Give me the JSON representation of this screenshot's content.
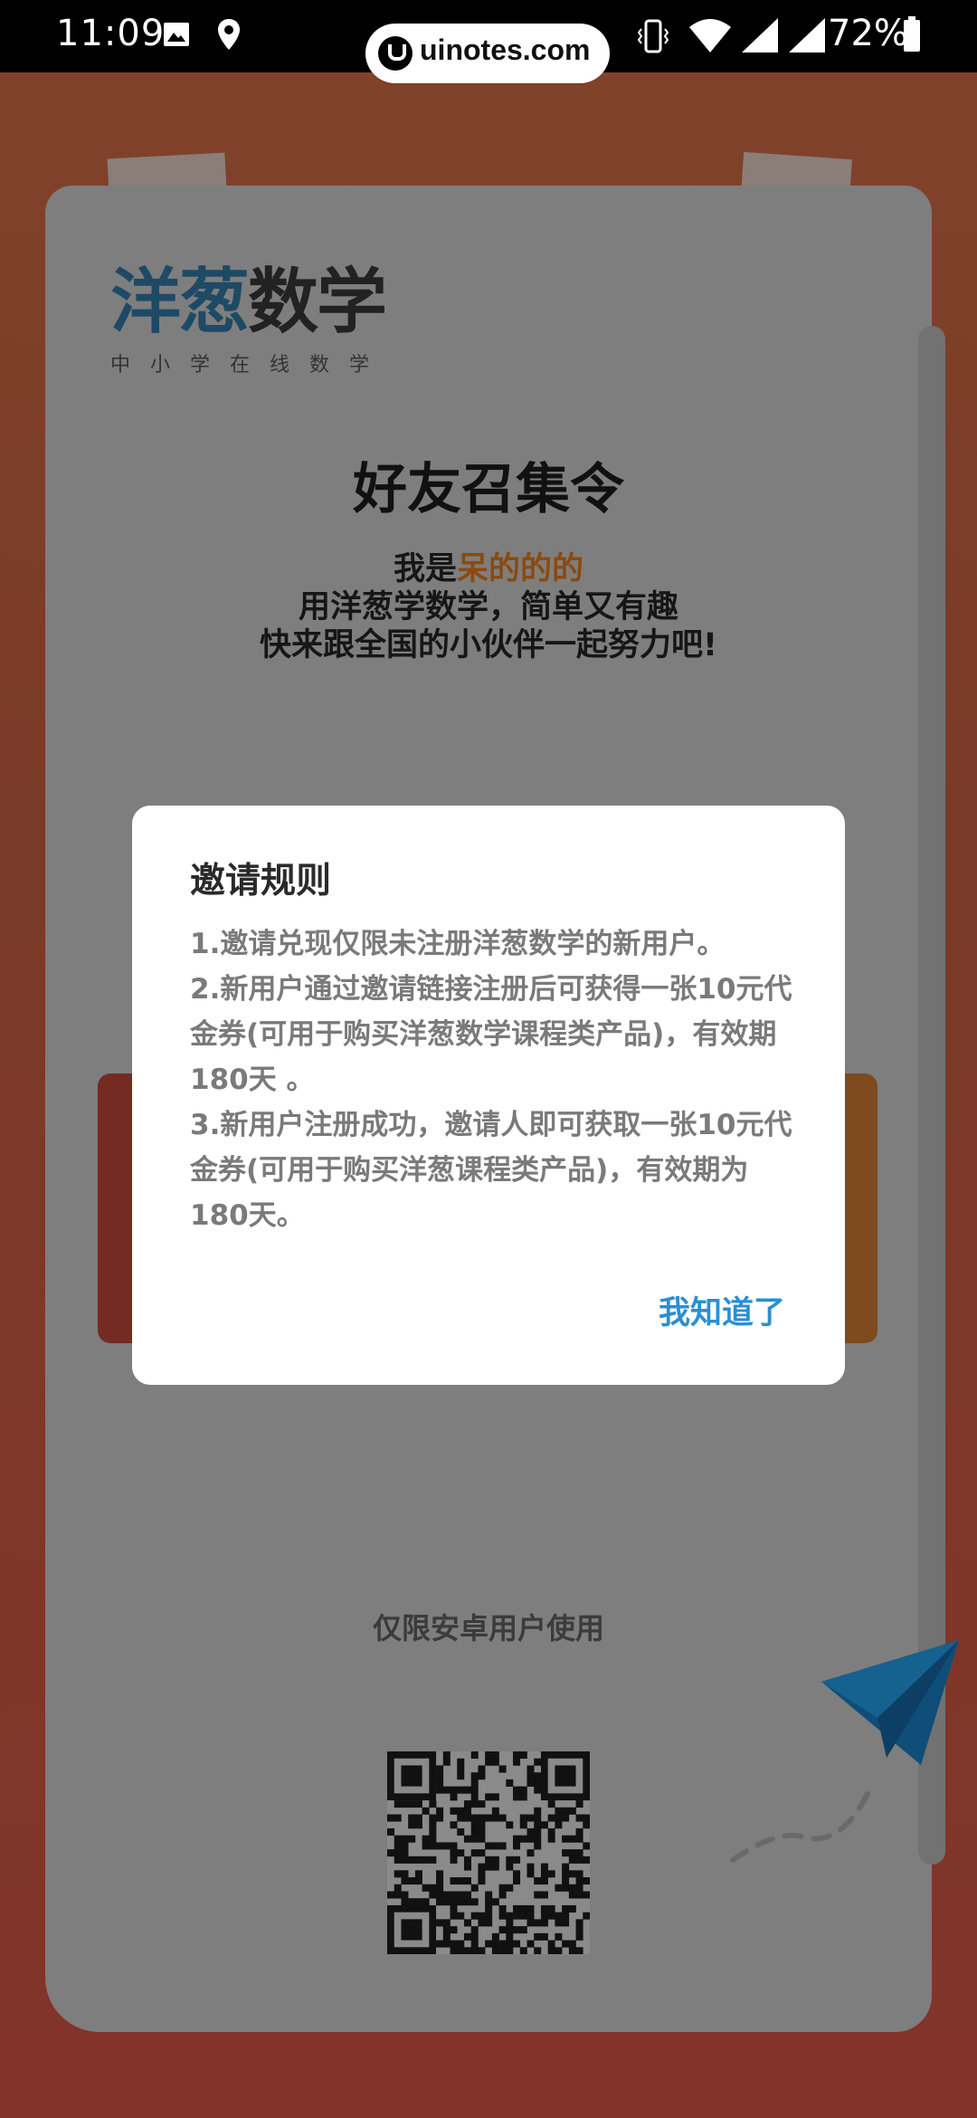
{
  "status_bar": {
    "time": "11:09",
    "battery": "72%"
  },
  "watermark": {
    "text": "uinotes.com"
  },
  "poster": {
    "brand_prefix": "洋葱",
    "brand_suffix": "数学",
    "brand_tagline": "中小学在线数学",
    "title": "好友召集令",
    "intro_prefix": "我是",
    "user_name": "呆的的的",
    "line2": "用洋葱学数学，简单又有趣",
    "line3": "快来跟全国的小伙伴一起努力吧!",
    "android_only": "仅限安卓用户使用"
  },
  "dialog": {
    "title": "邀请规则",
    "rules": [
      "1.邀请兑现仅限未注册洋葱数学的新用户。",
      "2.新用户通过邀请链接注册后可获得一张10元代金券(可用于购买洋葱数学课程类产品)，有效期180天 。",
      "3.新用户注册成功，邀请人即可获取一张10元代金券(可用于购买洋葱课程类产品)，有效期为180天。"
    ],
    "ok_label": "我知道了"
  },
  "colors": {
    "accent_blue": "#2a8fd4",
    "name_orange": "#e07a1f",
    "brand_blue": "#2479b5"
  }
}
